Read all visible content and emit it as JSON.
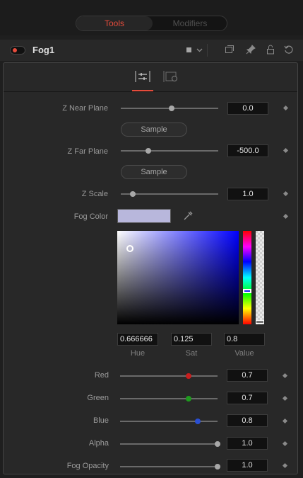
{
  "toolbar": {
    "tabs": [
      "Tools",
      "Modifiers"
    ]
  },
  "node": {
    "name": "Fog1"
  },
  "header_icons": [
    "color-swatch-icon",
    "chevron-down-icon",
    "windows-icon",
    "pin-icon",
    "lock-icon",
    "reset-icon"
  ],
  "subtabs": [
    "controls-tab-icon",
    "settings-tab-icon"
  ],
  "controls": {
    "z_near": {
      "label": "Z Near Plane",
      "value": "0.0",
      "slider": 0.52
    },
    "sample1": "Sample",
    "z_far": {
      "label": "Z Far Plane",
      "value": "-500.0",
      "slider": 0.28
    },
    "sample2": "Sample",
    "z_scale": {
      "label": "Z Scale",
      "value": "1.0",
      "slider": 0.12
    },
    "fog_color": {
      "label": "Fog Color",
      "swatch": "#b8b7dc"
    },
    "hue": {
      "label": "Hue",
      "value": "0.666666"
    },
    "sat": {
      "label": "Sat",
      "value": "0.125"
    },
    "val": {
      "label": "Value",
      "value": "0.8"
    },
    "red": {
      "label": "Red",
      "value": "0.7",
      "slider": 0.7,
      "color": "#c81e1e"
    },
    "green": {
      "label": "Green",
      "value": "0.7",
      "slider": 0.7,
      "color": "#1e9a1e"
    },
    "blue": {
      "label": "Blue",
      "value": "0.8",
      "slider": 0.8,
      "color": "#2a4fd2"
    },
    "alpha": {
      "label": "Alpha",
      "value": "1.0",
      "slider": 1.0
    },
    "fog_opacity": {
      "label": "Fog Opacity",
      "value": "1.0",
      "slider": 1.0
    }
  },
  "colors": {
    "accent": "#e64c3c",
    "panel": "#282828",
    "background": "#1f1f1f"
  }
}
